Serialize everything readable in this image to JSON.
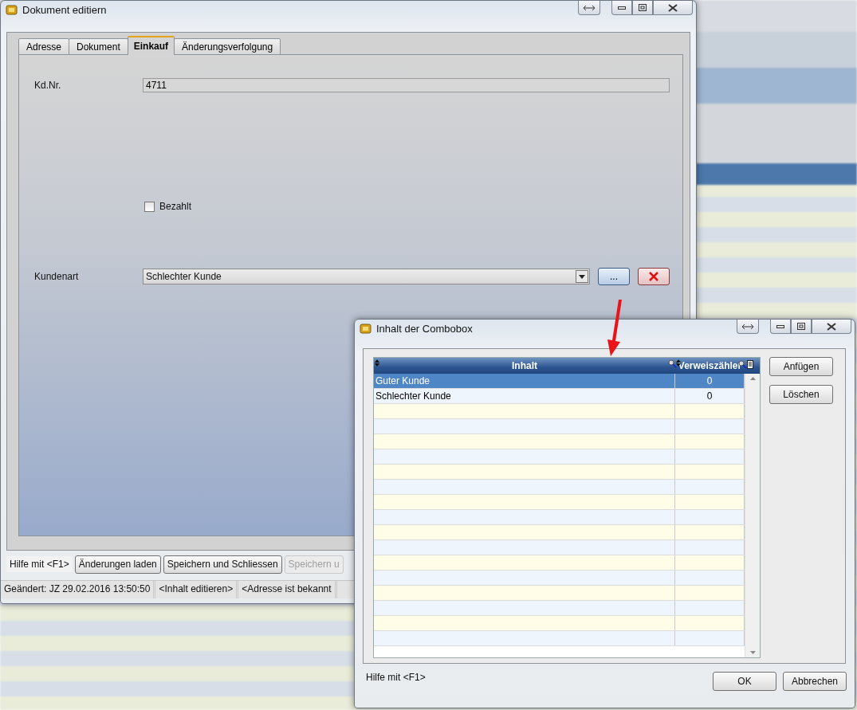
{
  "main_window": {
    "title": "Dokument editiern",
    "tabs": [
      {
        "label": "Adresse",
        "selected": false
      },
      {
        "label": "Dokument",
        "selected": false
      },
      {
        "label": "Einkauf",
        "selected": true
      },
      {
        "label": "Änderungsverfolgung",
        "selected": false
      }
    ],
    "fields": [
      {
        "kind": "text",
        "label": "Kd.Nr.",
        "value": "4711"
      },
      {
        "kind": "checkbox",
        "label": "Bezahlt",
        "checked": false
      },
      {
        "kind": "combobox",
        "label": "Kundenart",
        "value": "Schlechter Kunde",
        "more_button": "..."
      }
    ],
    "help": "Hilfe mit <F1>",
    "buttons": [
      {
        "label": "Änderungen laden",
        "disabled": false
      },
      {
        "label": "Speichern und Schliessen",
        "disabled": false
      },
      {
        "label": "Speichern u",
        "disabled": true
      }
    ],
    "status_bar": [
      "Geändert: JZ 29.02.2016 13:50:50",
      "<Inhalt editieren>",
      "<Adresse ist bekannt"
    ]
  },
  "dialog": {
    "title": "Inhalt der Combobox",
    "table": {
      "columns": [
        "Inhalt",
        "Verweiszähler"
      ],
      "rows": [
        {
          "cells": [
            "Guter Kunde",
            "0"
          ],
          "selected": true
        },
        {
          "cells": [
            "Schlechter Kunde",
            "0"
          ],
          "selected": false
        }
      ]
    },
    "side_buttons": [
      "Anfügen",
      "Löschen"
    ],
    "help": "Hilfe mit <F1>",
    "buttons": [
      "OK",
      "Abbrechen"
    ]
  }
}
